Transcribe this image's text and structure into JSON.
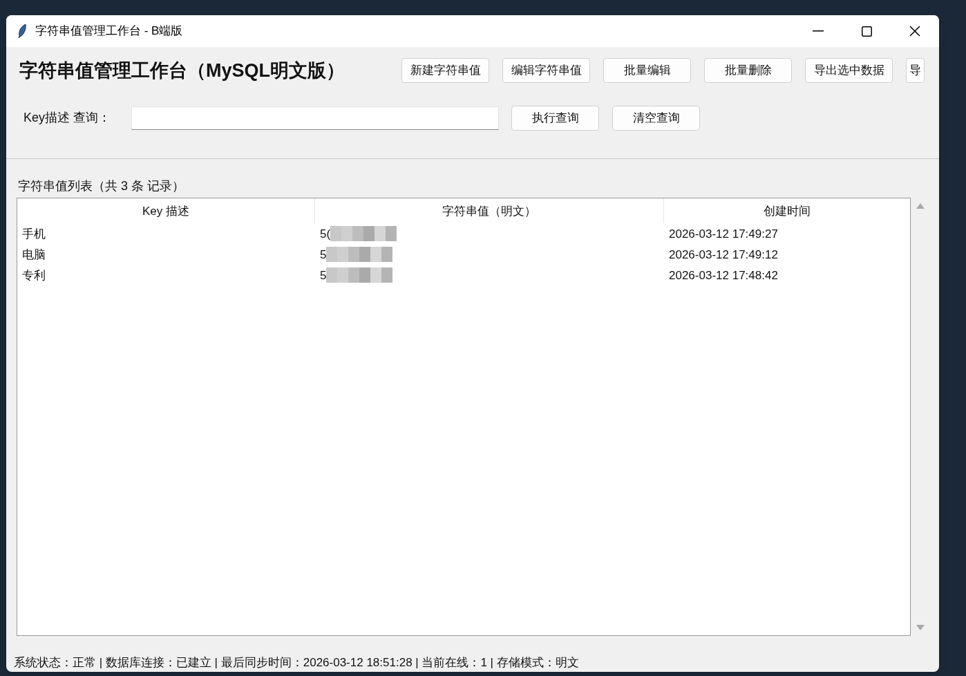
{
  "window": {
    "title": "字符串值管理工作台 - B端版"
  },
  "header": {
    "title": "字符串值管理工作台（MySQL明文版）",
    "buttons": [
      "新建字符串值",
      "编辑字符串值",
      "批量编辑",
      "批量删除",
      "导出选中数据",
      "导"
    ]
  },
  "search": {
    "label": "Key描述 查询：",
    "buttons": [
      "执行查询",
      "清空查询"
    ]
  },
  "list": {
    "caption": "字符串值列表（共 3 条 记录）",
    "columns": [
      "Key 描述",
      "字符串值（明文）",
      "创建时间"
    ],
    "rows": [
      {
        "key": "手机",
        "value": "5(",
        "redacted": true,
        "created": "2026-03-12 17:49:27"
      },
      {
        "key": "电脑",
        "value": "5",
        "redacted": true,
        "created": "2026-03-12 17:49:12"
      },
      {
        "key": "专利",
        "value": "5",
        "redacted": true,
        "created": "2026-03-12 17:48:42"
      }
    ]
  },
  "status_bar": "系统状态：正常 | 数据库连接：已建立 | 最后同步时间：2026-03-12 18:51:28 | 当前在线：1 | 存储模式：明文"
}
